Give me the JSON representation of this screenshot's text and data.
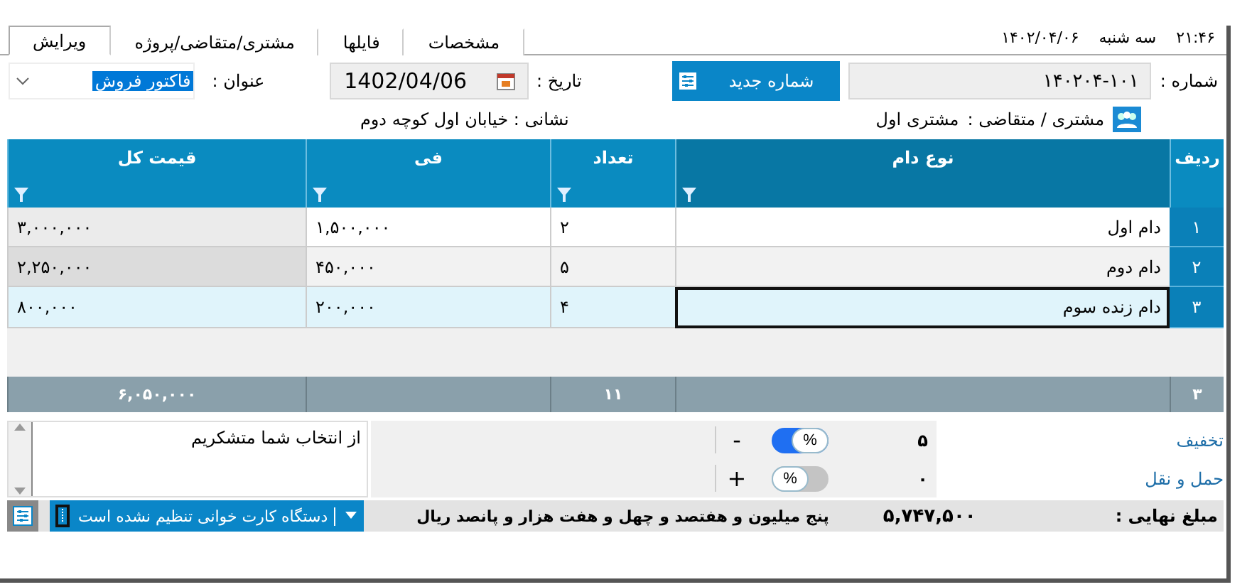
{
  "clock": {
    "time": "۲۱:۴۶",
    "weekday": "سه شنبه",
    "date": "۱۴۰۲/۰۴/۰۶"
  },
  "tabs": [
    {
      "label": "مشخصات",
      "selected": false
    },
    {
      "label": "فایلها",
      "selected": false
    },
    {
      "label": "مشتری/متقاضی/پروژه",
      "selected": false
    },
    {
      "label": "ویرایش",
      "selected": true
    }
  ],
  "form": {
    "number_label": "شماره :",
    "number": "۱۴۰۲۰۴-۱۰۱",
    "new_number_button": "شماره جدید",
    "date_label": "تاریخ :",
    "date": "1402/04/06",
    "title_label": "عنوان :",
    "title": "فاکتور فروش",
    "customer_label": "مشتری / متقاضی :",
    "customer": "مشتری اول",
    "address": "نشانی : خیابان اول کوچه دوم"
  },
  "table": {
    "columns": [
      "ردیف",
      "نوع دام",
      "تعداد",
      "فی",
      "قیمت کل"
    ],
    "rows": [
      {
        "cells": [
          "۱",
          "دام اول",
          "۲",
          "۱,۵۰۰,۰۰۰",
          "۳,۰۰۰,۰۰۰"
        ],
        "selected": false
      },
      {
        "cells": [
          "۲",
          "دام دوم",
          "۵",
          "۴۵۰,۰۰۰",
          "۲,۲۵۰,۰۰۰"
        ],
        "selected": false
      },
      {
        "cells": [
          "۳",
          "دام زنده سوم",
          "۴",
          "۲۰۰,۰۰۰",
          "۸۰۰,۰۰۰"
        ],
        "selected": true
      }
    ],
    "footer": {
      "row_count": "۳",
      "quantity": "۱۱",
      "total": "۶,۰۵۰,۰۰۰"
    }
  },
  "note": "از انتخاب شما متشکریم",
  "adjustments": [
    {
      "label": "تخفیف",
      "sign": "-",
      "unit": "%",
      "on": true,
      "value": "۵"
    },
    {
      "label": "حمل و نقل",
      "sign": "+",
      "unit": "%",
      "on": false,
      "value": "۰"
    }
  ],
  "summary": {
    "label": "مبلغ نهایی :",
    "amount": "۵,۷۴۷,۵۰۰",
    "words": "پنج میلیون و هفتصد و چهل و هفت هزار و پانصد ریال",
    "card_reader": "دستگاه کارت خوانی تنظیم نشده است"
  }
}
